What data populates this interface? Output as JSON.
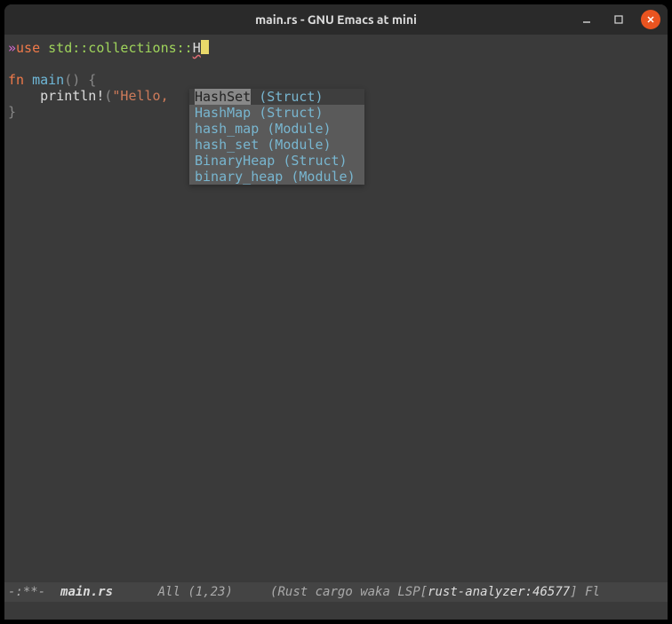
{
  "window": {
    "title": "main.rs - GNU Emacs at mini"
  },
  "code": {
    "line1_marker": "»",
    "line1_use": "use",
    "line1_path": " std::collections::",
    "line1_typed": "H",
    "line3_fn": "fn",
    "line3_main": " main",
    "line3_parens": "() {",
    "line4_indent": "    ",
    "line4_macro": "println!",
    "line4_paren_open": "(",
    "line4_string": "\"Hello,",
    "line5_brace": "}"
  },
  "completion": {
    "items": [
      {
        "name": "HashSet",
        "kind": "(Struct)",
        "selected": true
      },
      {
        "name": "HashMap",
        "kind": "(Struct)",
        "selected": false
      },
      {
        "name": "hash_map",
        "kind": "(Module)",
        "selected": false
      },
      {
        "name": "hash_set",
        "kind": "(Module)",
        "selected": false
      },
      {
        "name": "BinaryHeap",
        "kind": "(Struct)",
        "selected": false
      },
      {
        "name": "binary_heap",
        "kind": "(Module)",
        "selected": false
      }
    ]
  },
  "modeline": {
    "left": "-:**-  ",
    "file": "main.rs",
    "mid": "      All (1,23)     ",
    "mode_open": "(Rust cargo waka LSP[",
    "analyzer": "rust-analyzer:46577",
    "mode_close": "] Fl"
  }
}
